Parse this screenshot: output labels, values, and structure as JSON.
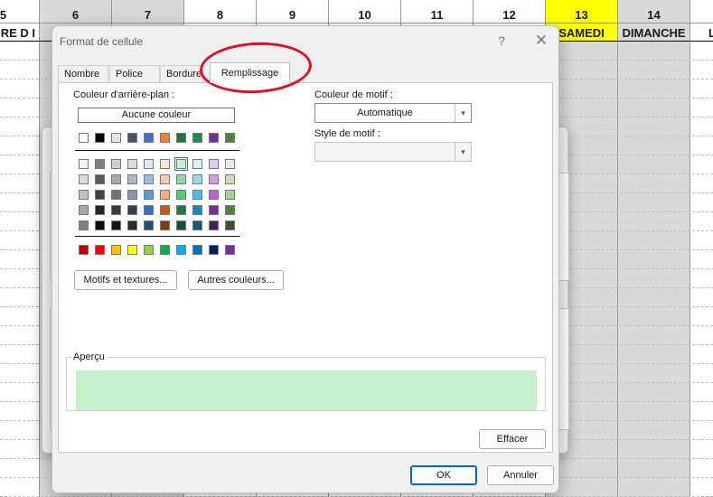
{
  "spreadsheet": {
    "columns": [
      {
        "num": "5",
        "day": "ORE D I"
      },
      {
        "num": "6",
        "day": ""
      },
      {
        "num": "7",
        "day": ""
      },
      {
        "num": "8",
        "day": ""
      },
      {
        "num": "9",
        "day": ""
      },
      {
        "num": "10",
        "day": ""
      },
      {
        "num": "11",
        "day": ""
      },
      {
        "num": "12",
        "day": ""
      },
      {
        "num": "13",
        "day": "SAMEDI"
      },
      {
        "num": "14",
        "day": "DIMANCHE"
      },
      {
        "num": "",
        "day": "L"
      }
    ]
  },
  "dialog": {
    "title": "Format de cellule",
    "help_glyph": "?",
    "close_glyph": "✕",
    "tabs": [
      "Nombre",
      "Police",
      "Bordure",
      "Remplissage"
    ],
    "active_tab": "Remplissage",
    "background_color_label": "Couleur d'arrière-plan :",
    "no_color_button": "Aucune couleur",
    "pattern_color_label": "Couleur de motif :",
    "pattern_color_value": "Automatique",
    "pattern_style_label": "Style de motif :",
    "pattern_style_value": "",
    "patterns_button": "Motifs et textures...",
    "more_colors_button": "Autres couleurs...",
    "preview_label": "Aperçu",
    "preview_color": "#c6efce",
    "clear_button": "Effacer",
    "ok_button": "OK",
    "cancel_button": "Annuler"
  },
  "palette": {
    "theme_row": [
      "#ffffff",
      "#000000",
      "#e7e6e6",
      "#44546a",
      "#4472c4",
      "#ed7d31",
      "#1e7145",
      "#1f8b4c",
      "#7030a0",
      "#548235"
    ],
    "tint_rows": [
      [
        "#f2f2f2",
        "#7f7f7f",
        "#d0cece",
        "#d6dce4",
        "#ddebf7",
        "#fce4d6",
        "#c6efce",
        "#d9f0f9",
        "#e4c9f0",
        "#e2efda"
      ],
      [
        "#d9d9d9",
        "#595959",
        "#aeaaaa",
        "#adb9ca",
        "#9bc2e6",
        "#f8cbad",
        "#8fd9a8",
        "#9ad8ee",
        "#d39be0",
        "#c6e0b4"
      ],
      [
        "#bfbfbf",
        "#404040",
        "#767171",
        "#8497b0",
        "#5b9bd5",
        "#f4b084",
        "#4ccf73",
        "#4bbde6",
        "#c060d0",
        "#a9d08e"
      ],
      [
        "#a6a6a6",
        "#262626",
        "#3a3838",
        "#333f4f",
        "#2f75b5",
        "#c65911",
        "#1e7a3c",
        "#1a86b8",
        "#7a2b8f",
        "#548235"
      ],
      [
        "#808080",
        "#0d0d0d",
        "#171616",
        "#222b35",
        "#1f4e78",
        "#833c0c",
        "#14502a",
        "#125a7a",
        "#4d1b5a",
        "#375623"
      ]
    ],
    "standard_row": [
      "#c00000",
      "#ff0000",
      "#ffc000",
      "#ffff00",
      "#92d050",
      "#00b050",
      "#00b0f0",
      "#0070c0",
      "#002060",
      "#7030a0"
    ],
    "selected": "#c6efce"
  }
}
